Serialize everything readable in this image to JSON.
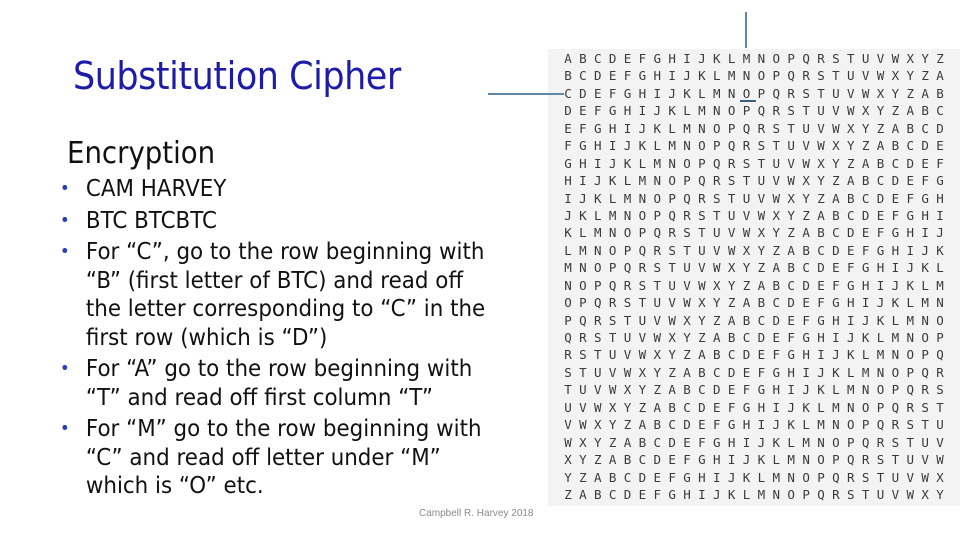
{
  "slide": {
    "title": "Substitution Cipher",
    "subtitle": "Encryption",
    "bullets": [
      {
        "lines": [
          "CAM HARVEY"
        ]
      },
      {
        "lines": [
          "BTC   BTCBTC"
        ]
      },
      {
        "lines": [
          "For “C”, go to the row beginning with",
          "“B” (first letter of BTC) and read off",
          "the letter corresponding to “C” in the",
          "first row (which is “D”)"
        ]
      },
      {
        "lines": [
          "For “A” go to the row beginning with",
          "“T” and read off first column “T”"
        ]
      },
      {
        "lines": [
          "For “M” go to the row beginning with",
          "“C” and read off letter under “M”",
          "which is “O” etc."
        ]
      }
    ],
    "bullet_glyph": "•",
    "footer": "Campbell R. Harvey 2018",
    "colors": {
      "title": "#1c1ca8",
      "bullet": "#2a3fc4",
      "arrow": "#5f87a6"
    }
  },
  "cipher_table": {
    "alphabet": "ABCDEFGHIJKLMNOPQRSTUVWXYZ",
    "rows": [
      "ABCDEFGHIJKLMNOPQRSTUVWXYZ",
      "BCDEFGHIJKLMNOPQRSTUVWXYZA",
      "CDEFGHIJKLMNOPQRSTUVWXYZAB",
      "DEFGHIJKLMNOPQRSTUVWXYZABC",
      "EFGHIJKLMNOPQRSTUVWXYZABCD",
      "FGHIJKLMNOPQRSTUVWXYZABCDE",
      "GHIJKLMNOPQRSTUVWXYZABCDEF",
      "HIJKLMNOPQRSTUVWXYZABCDEFG",
      "IJKLMNOPQRSTUVWXYZABCDEFGH",
      "JKLMNOPQRSTUVWXYZABCDEFGHI",
      "KLMNOPQRSTUVWXYZABCDEFGHIJ",
      "LMNOPQRSTUVWXYZABCDEFGHIJK",
      "MNOPQRSTUVWXYZABCDEFGHIJKL",
      "NOPQRSTUVWXYZABCDEFGHIJKLM",
      "OPQRSTUVWXYZABCDEFGHIJKLMN",
      "PQRSTUVWXYZABCDEFGHIJKLMNO",
      "QRSTUVWXYZABCDEFGHIJKLMNOP",
      "RSTUVWXYZABCDEFGHIJKLMNOPQ",
      "STUVWXYZABCDEFGHIJKLMNOPQR",
      "TUVWXYZABCDEFGHIJKLMNOPQRS",
      "UVWXYZABCDEFGHIJKLMNOPQRST",
      "VWXYZABCDEFGHIJKLMNOPQRSTU",
      "WXYZABCDEFGHIJKLMNOPQRSTUV",
      "XYZABCDEFGHIJKLMNOPQRSTUVW",
      "YZABCDEFGHIJKLMNOPQRSTUVWX",
      "ZABCDEFGHIJKLMNOPQRSTUVWXY"
    ],
    "highlight": {
      "row_label": "C",
      "column_label": "M",
      "result": "O"
    }
  }
}
